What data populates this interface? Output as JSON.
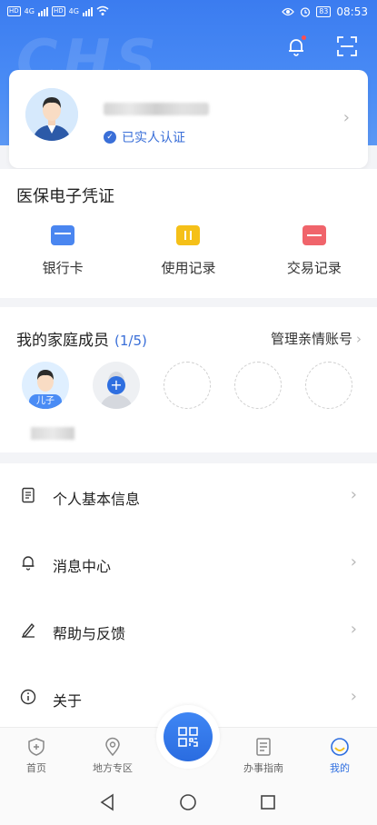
{
  "status_bar": {
    "net1": "4G",
    "net2": "4G",
    "battery": "83",
    "time": "08:53"
  },
  "hero": {
    "watermark": "CHS"
  },
  "profile": {
    "verified_label": "已实人认证"
  },
  "credentials": {
    "title": "医保电子凭证",
    "items": [
      {
        "label": "银行卡",
        "icon": "bank-card-icon",
        "color": "#4a86f0"
      },
      {
        "label": "使用记录",
        "icon": "usage-record-icon",
        "color": "#f5c018"
      },
      {
        "label": "交易记录",
        "icon": "transaction-record-icon",
        "color": "#f0646b"
      }
    ]
  },
  "family": {
    "title": "我的家庭成员",
    "count": "(1/5)",
    "manage_label": "管理亲情账号",
    "son_tag": "儿子"
  },
  "menu": {
    "items": [
      {
        "label": "个人基本信息",
        "icon": "document-icon"
      },
      {
        "label": "消息中心",
        "icon": "bell-icon"
      },
      {
        "label": "帮助与反馈",
        "icon": "pen-icon"
      },
      {
        "label": "关于",
        "icon": "info-icon"
      }
    ]
  },
  "tabbar": {
    "tabs": [
      {
        "label": "首页",
        "icon": "shield-home-icon"
      },
      {
        "label": "地方专区",
        "icon": "location-pin-icon"
      },
      {
        "label": "办事指南",
        "icon": "guide-document-icon"
      },
      {
        "label": "我的",
        "icon": "profile-face-icon"
      }
    ],
    "fab_icon": "qr-scan-icon"
  },
  "colors": {
    "accent": "#2f6fe0",
    "hero": "#4a8cf5",
    "badge_red": "#ff4d4f"
  }
}
